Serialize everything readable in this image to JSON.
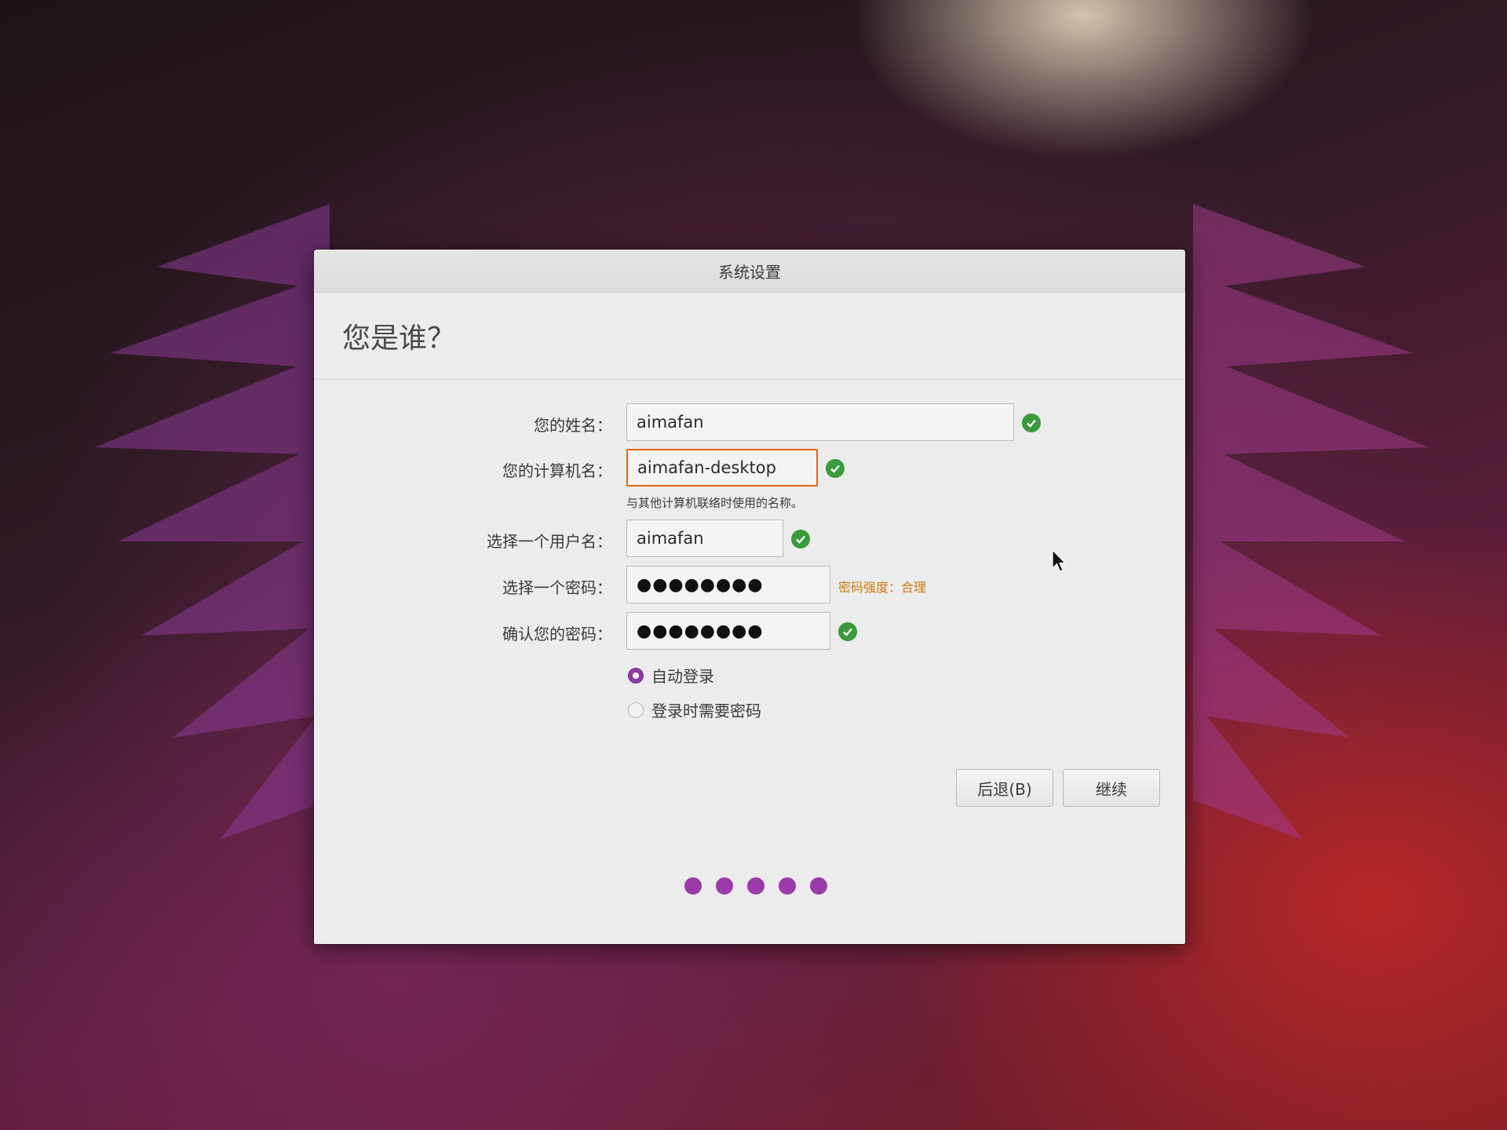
{
  "window": {
    "title": "系统设置"
  },
  "page": {
    "heading": "您是谁？"
  },
  "form": {
    "name": {
      "label": "您的姓名：",
      "value": "aimafan"
    },
    "computer_name": {
      "label": "您的计算机名：",
      "value": "aimafan-desktop",
      "hint": "与其他计算机联络时使用的名称。"
    },
    "username": {
      "label": "选择一个用户名：",
      "value": "aimafan"
    },
    "password": {
      "label": "选择一个密码：",
      "value": "●●●●●●●●",
      "strength": "密码强度：合理"
    },
    "confirm_password": {
      "label": "确认您的密码：",
      "value": "●●●●●●●●"
    },
    "login_options": [
      {
        "label": "自动登录",
        "selected": true
      },
      {
        "label": "登录时需要密码",
        "selected": false
      }
    ]
  },
  "buttons": {
    "back": "后退(B)",
    "continue": "继续"
  },
  "progress": {
    "total_steps": 5
  },
  "colors": {
    "accent": "#9a3aa8",
    "valid": "#3a9a3c",
    "focus": "#e0651e",
    "strength": "#d07a10"
  }
}
